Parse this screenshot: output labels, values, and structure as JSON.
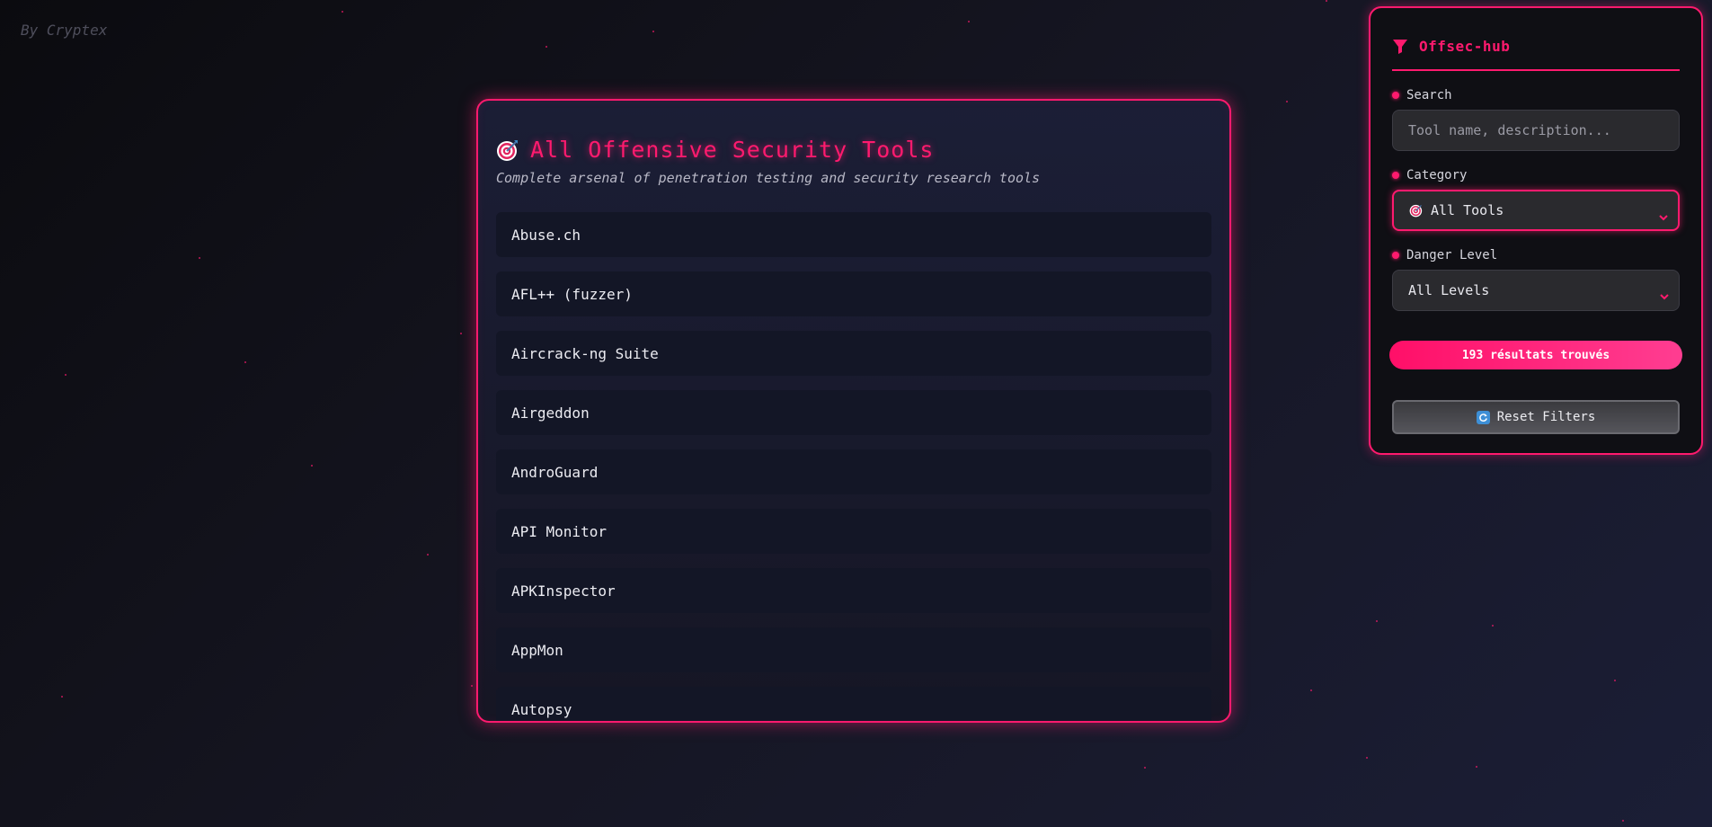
{
  "byline": "By Cryptex",
  "main": {
    "title": "All Offensive Security Tools",
    "subtitle": "Complete arsenal of penetration testing and security research tools",
    "icon": "target-icon",
    "tools": [
      {
        "name": "Abuse.ch"
      },
      {
        "name": "AFL++ (fuzzer)"
      },
      {
        "name": "Aircrack-ng Suite"
      },
      {
        "name": "Airgeddon"
      },
      {
        "name": "AndroGuard"
      },
      {
        "name": "API Monitor"
      },
      {
        "name": "APKInspector"
      },
      {
        "name": "AppMon"
      },
      {
        "name": "Autopsy"
      }
    ]
  },
  "sidebar": {
    "title": "Offsec-hub",
    "icon": "funnel-icon",
    "search": {
      "label": "Search",
      "placeholder": "Tool name, description...",
      "value": ""
    },
    "category": {
      "label": "Category",
      "selected": "All Tools",
      "icon": "target-icon"
    },
    "danger_level": {
      "label": "Danger Level",
      "selected": "All Levels"
    },
    "results_text": "193 résultats trouvés",
    "reset_label": "Reset Filters"
  },
  "colors": {
    "accent": "#ff1a6e",
    "background": "#151521",
    "panel": "#131626",
    "sidebar_bg": "#0f0f14"
  }
}
